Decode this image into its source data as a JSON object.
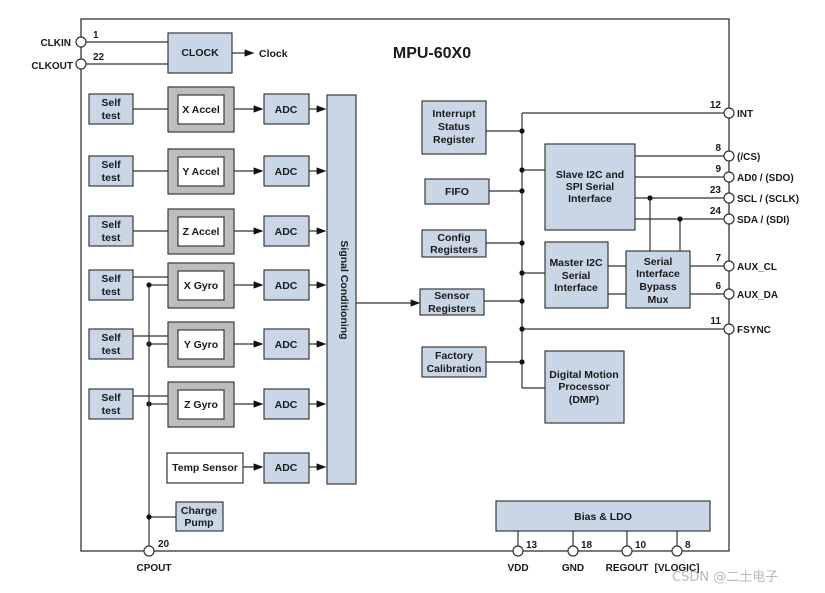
{
  "title": "MPU-60X0",
  "clock": {
    "block": "CLOCK",
    "output": "Clock",
    "pins": [
      {
        "name": "CLKIN",
        "number": "1"
      },
      {
        "name": "CLKOUT",
        "number": "22"
      }
    ]
  },
  "sensors": [
    {
      "self_test": [
        "Self",
        "test"
      ],
      "sensor": "X Accel",
      "adc": "ADC"
    },
    {
      "self_test": [
        "Self",
        "test"
      ],
      "sensor": "Y Accel",
      "adc": "ADC"
    },
    {
      "self_test": [
        "Self",
        "test"
      ],
      "sensor": "Z Accel",
      "adc": "ADC"
    },
    {
      "self_test": [
        "Self",
        "test"
      ],
      "sensor": "X Gyro",
      "adc": "ADC"
    },
    {
      "self_test": [
        "Self",
        "test"
      ],
      "sensor": "Y Gyro",
      "adc": "ADC"
    },
    {
      "self_test": [
        "Self",
        "test"
      ],
      "sensor": "Z Gyro",
      "adc": "ADC"
    }
  ],
  "temp": {
    "sensor": "Temp Sensor",
    "adc": "ADC"
  },
  "charge_pump": [
    "Charge",
    "Pump"
  ],
  "signal_conditioning": "Signal Conditioning",
  "registers": {
    "interrupt": [
      "Interrupt",
      "Status",
      "Register"
    ],
    "fifo": "FIFO",
    "config": [
      "Config",
      "Registers"
    ],
    "sensor": [
      "Sensor",
      "Registers"
    ],
    "factory": [
      "Factory",
      "Calibration"
    ]
  },
  "slave_if": [
    "Slave I2C and",
    "SPI Serial",
    "Interface"
  ],
  "master_if": [
    "Master I2C",
    "Serial",
    "Interface"
  ],
  "bypass_mux": [
    "Serial",
    "Interface",
    "Bypass",
    "Mux"
  ],
  "dmp": [
    "Digital Motion",
    "Processor",
    "(DMP)"
  ],
  "bias_ldo": "Bias & LDO",
  "right_pins": [
    {
      "number": "12",
      "name": "INT"
    },
    {
      "number": "8",
      "name": "(/CS)"
    },
    {
      "number": "9",
      "name": "AD0 / (SDO)"
    },
    {
      "number": "23",
      "name": "SCL / (SCLK)"
    },
    {
      "number": "24",
      "name": "SDA / (SDI)"
    },
    {
      "number": "7",
      "name": "AUX_CL"
    },
    {
      "number": "6",
      "name": "AUX_DA"
    },
    {
      "number": "11",
      "name": "FSYNC"
    }
  ],
  "bottom_pins": [
    {
      "number": "20",
      "name": "CPOUT"
    },
    {
      "number": "13",
      "name": "VDD"
    },
    {
      "number": "18",
      "name": "GND"
    },
    {
      "number": "10",
      "name": "REGOUT"
    },
    {
      "number": "8",
      "name": "[VLOGIC]"
    }
  ],
  "watermark": "CSDN @二土电子"
}
